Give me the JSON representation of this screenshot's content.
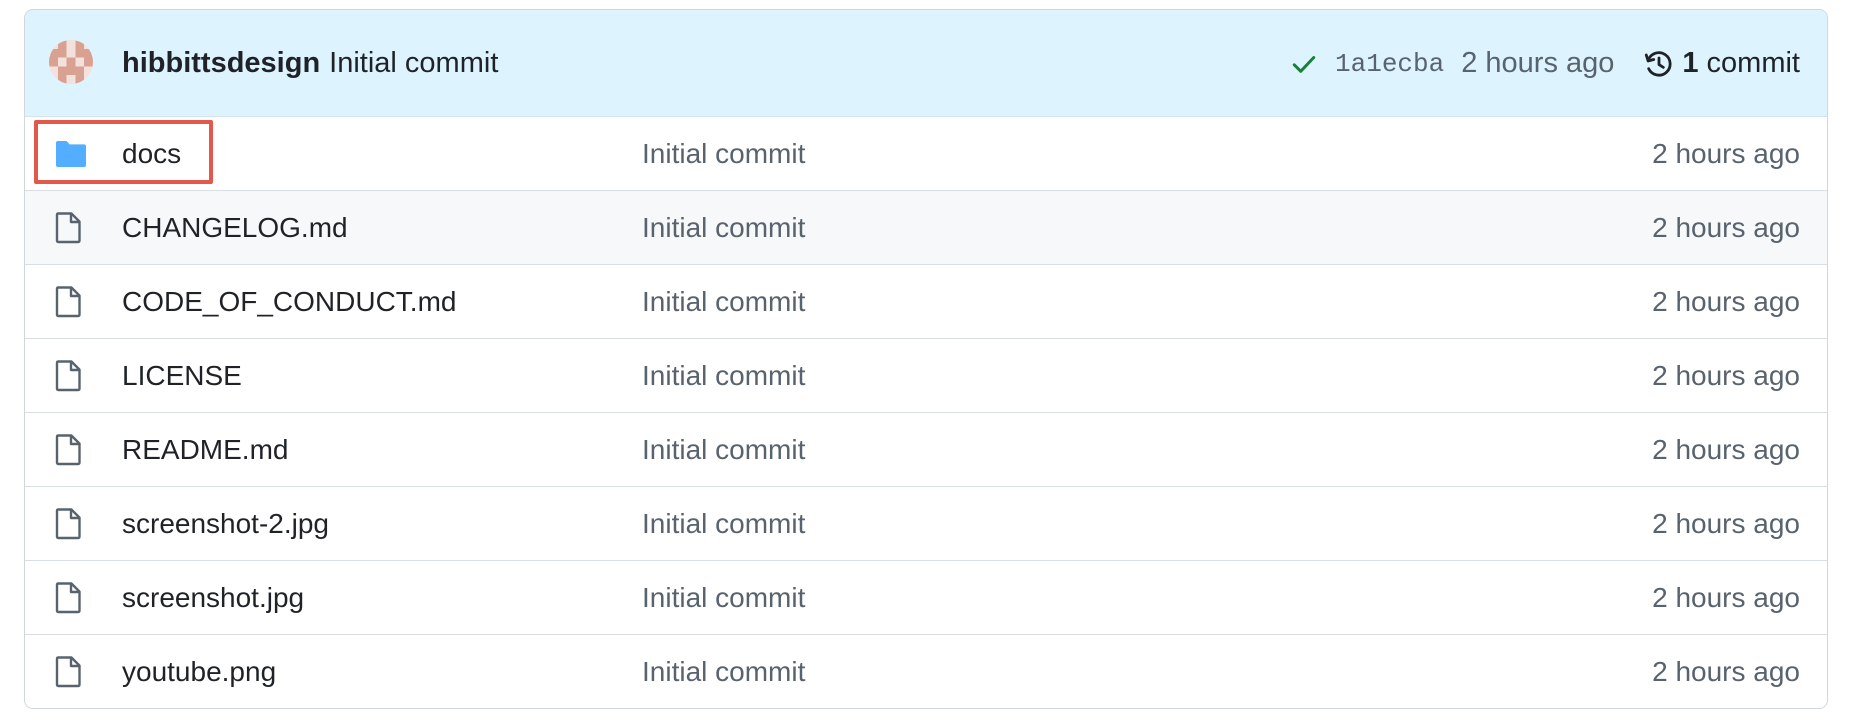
{
  "latest_commit": {
    "author": "hibbittsdesign",
    "message": "Initial commit",
    "status_icon": "check-icon",
    "status_color": "#1a7f37",
    "sha": "1a1ecba",
    "time": "2 hours ago",
    "history_count": "1",
    "history_label": "commit"
  },
  "files": [
    {
      "type": "folder",
      "icon": "folder-icon",
      "name": "docs",
      "commit": "Initial commit",
      "age": "2 hours ago",
      "highlighted": true
    },
    {
      "type": "file",
      "icon": "file-icon",
      "name": "CHANGELOG.md",
      "commit": "Initial commit",
      "age": "2 hours ago"
    },
    {
      "type": "file",
      "icon": "file-icon",
      "name": "CODE_OF_CONDUCT.md",
      "commit": "Initial commit",
      "age": "2 hours ago"
    },
    {
      "type": "file",
      "icon": "file-icon",
      "name": "LICENSE",
      "commit": "Initial commit",
      "age": "2 hours ago"
    },
    {
      "type": "file",
      "icon": "file-icon",
      "name": "README.md",
      "commit": "Initial commit",
      "age": "2 hours ago"
    },
    {
      "type": "file",
      "icon": "file-icon",
      "name": "screenshot-2.jpg",
      "commit": "Initial commit",
      "age": "2 hours ago"
    },
    {
      "type": "file",
      "icon": "file-icon",
      "name": "screenshot.jpg",
      "commit": "Initial commit",
      "age": "2 hours ago"
    },
    {
      "type": "file",
      "icon": "file-icon",
      "name": "youtube.png",
      "commit": "Initial commit",
      "age": "2 hours ago"
    }
  ],
  "colors": {
    "header_bg": "#ddf4ff",
    "folder_icon": "#54aeff",
    "highlight_border": "#e0594a",
    "muted_text": "#59636e"
  }
}
